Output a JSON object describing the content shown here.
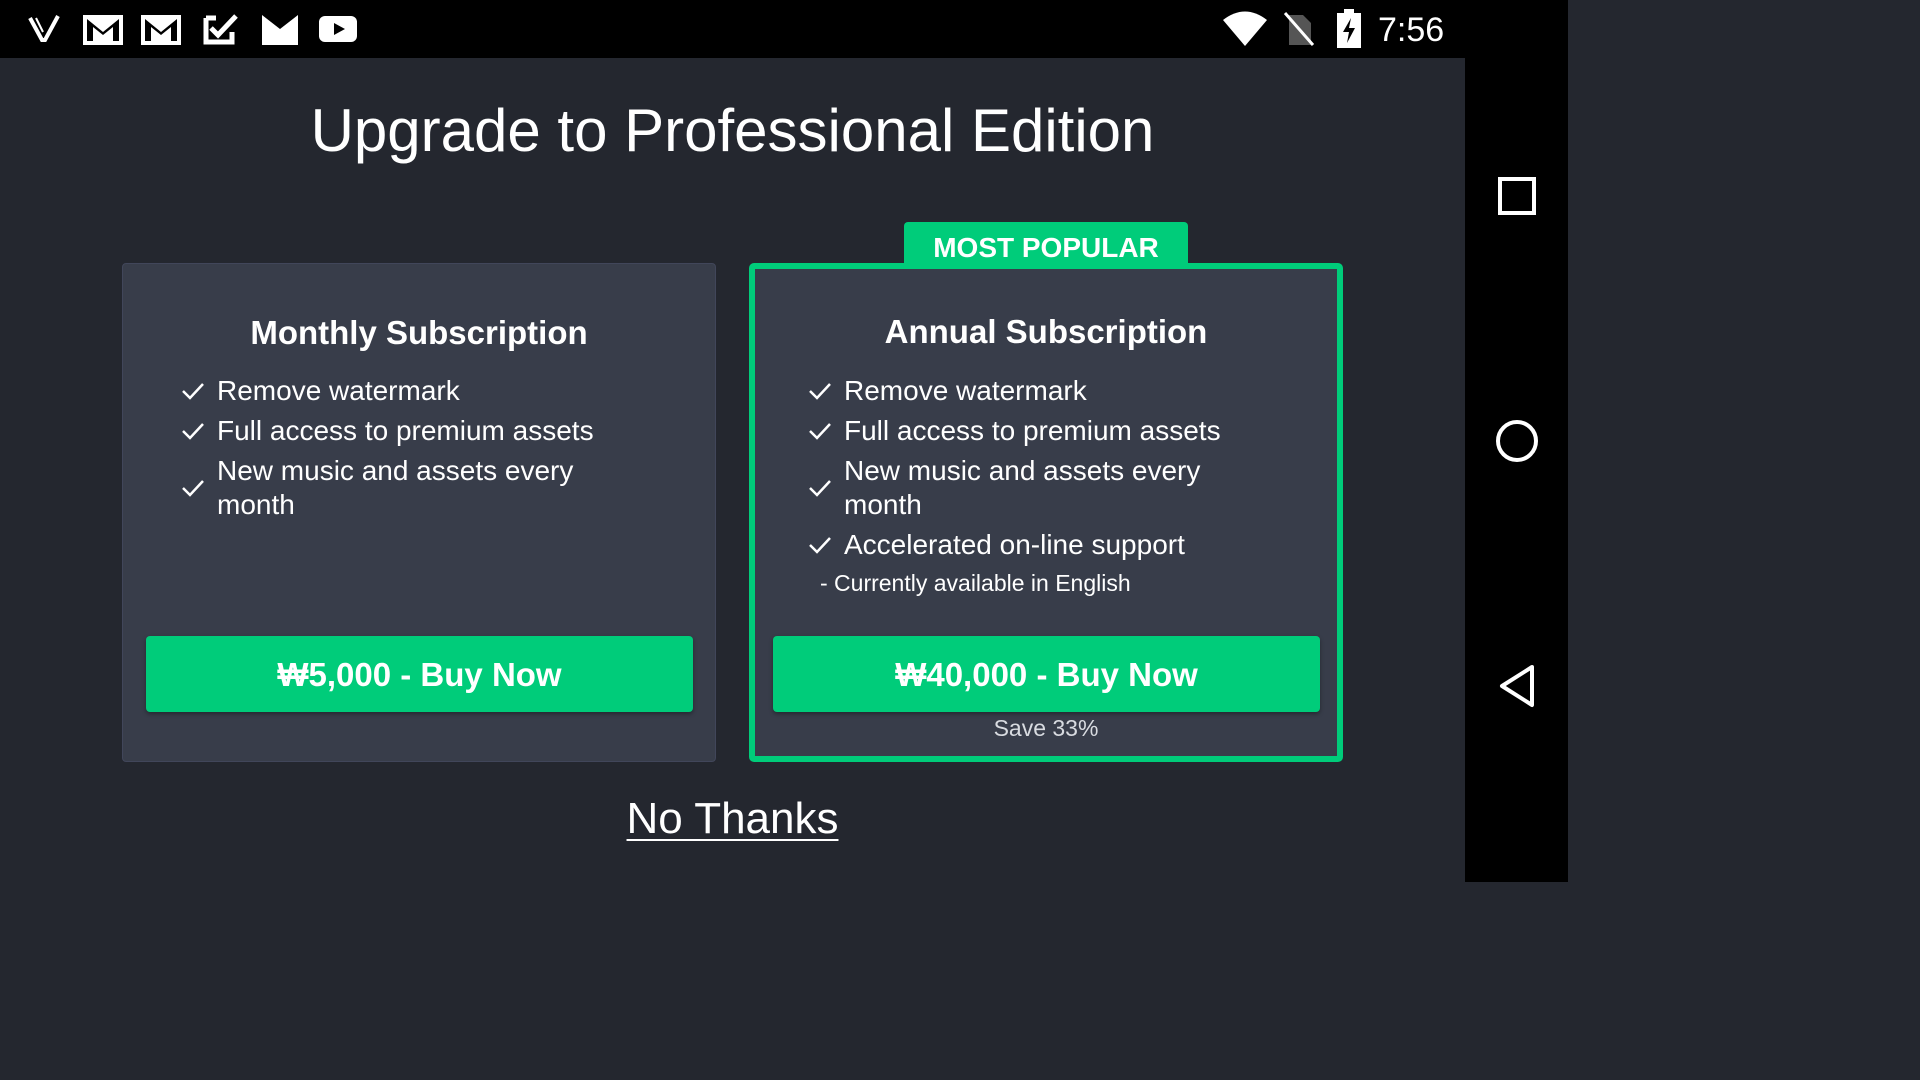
{
  "status_bar": {
    "time": "7:56",
    "left_icons": [
      "vllo-app-icon",
      "gmail-icon",
      "gmail-icon",
      "tasks-check-icon",
      "gmail-m-icon",
      "youtube-icon"
    ],
    "right_icons": [
      "wifi-icon",
      "no-sim-icon",
      "battery-charging-icon"
    ]
  },
  "nav_bar": {
    "icons": [
      "recent-apps-icon",
      "home-icon",
      "back-icon"
    ]
  },
  "page": {
    "title": "Upgrade to Professional Edition",
    "no_thanks": "No Thanks"
  },
  "monthly": {
    "title": "Monthly Subscription",
    "features": [
      "Remove watermark",
      "Full access to premium assets",
      "New music and assets every month"
    ],
    "buy_label": "₩5,000 - Buy Now"
  },
  "annual": {
    "badge": "MOST POPULAR",
    "title": "Annual Subscription",
    "features": [
      "Remove watermark",
      "Full access to premium assets",
      "New music and assets every month",
      "Accelerated on-line support"
    ],
    "support_note": "- Currently available in English",
    "buy_label": "₩40,000 - Buy Now",
    "save_note": "Save 33%"
  },
  "colors": {
    "background": "#24272f",
    "card": "#383d4a",
    "accent": "#00cc7a",
    "text": "#ffffff"
  }
}
